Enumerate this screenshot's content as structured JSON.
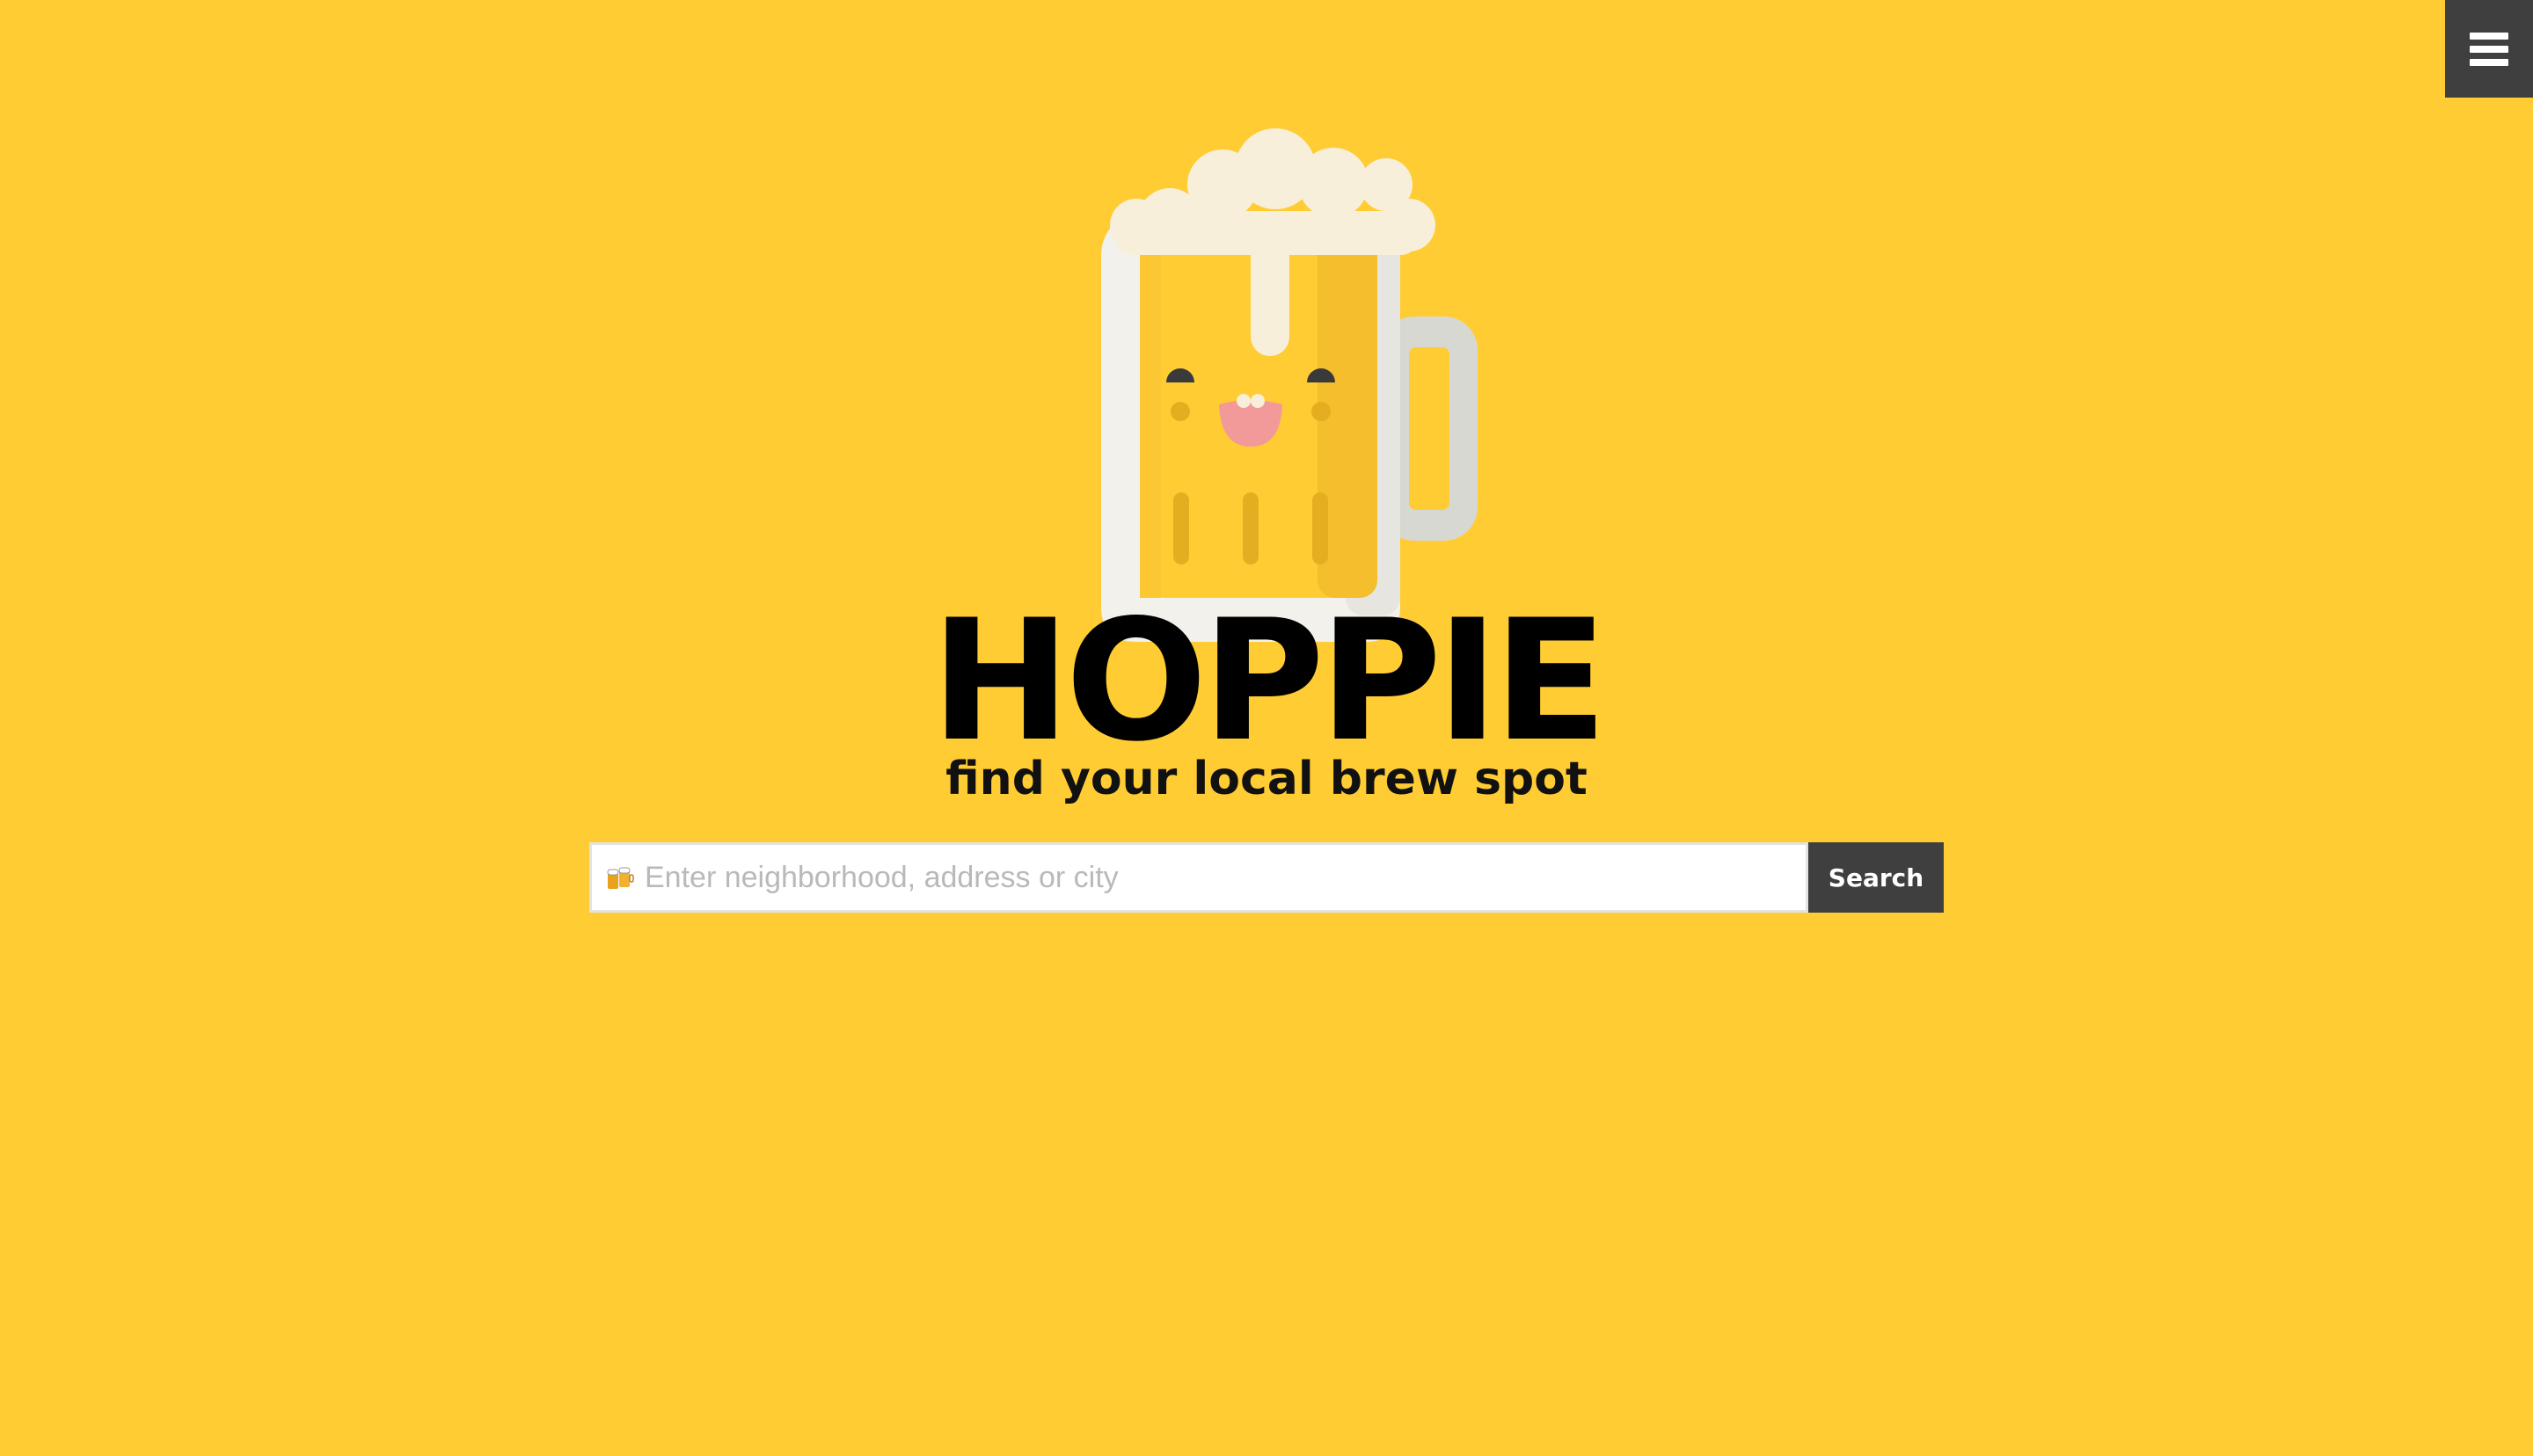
{
  "header": {
    "menu_icon": "hamburger-menu-icon"
  },
  "hero": {
    "mascot_icon": "beer-mug-mascot-icon",
    "title": "HOPPIE",
    "tagline": "find your local brew spot"
  },
  "search": {
    "icon": "beers-emoji-icon",
    "placeholder": "Enter neighborhood, address or city",
    "value": "",
    "button_label": "Search"
  },
  "colors": {
    "background": "#FFCC33",
    "button_dark": "#3F3F3F",
    "text": "#000000"
  }
}
